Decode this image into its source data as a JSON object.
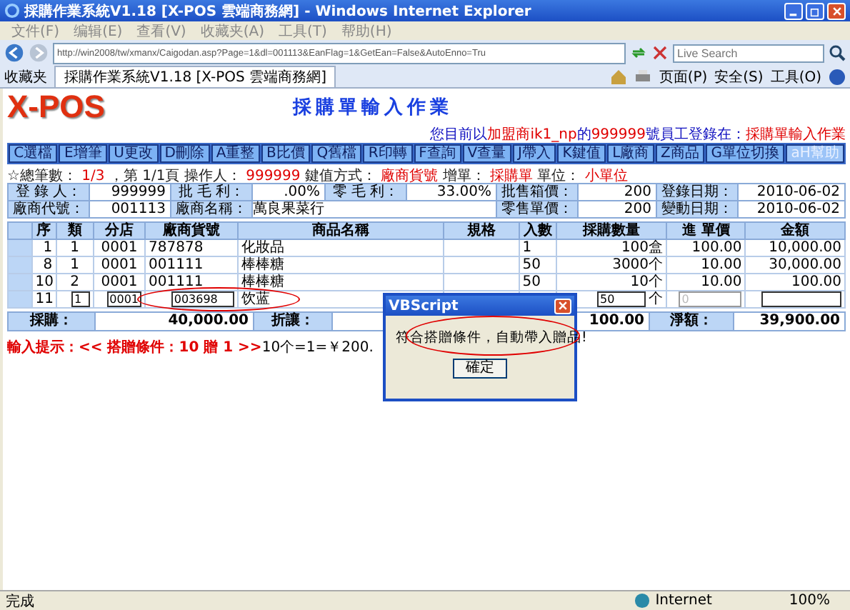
{
  "window": {
    "title": "採購作業系統V1.18 [X-POS 雲端商務網] - Windows Internet Explorer"
  },
  "menu": [
    "文件(F)",
    "编辑(E)",
    "查看(V)",
    "收藏夹(A)",
    "工具(T)",
    "帮助(H)"
  ],
  "address_bar": {
    "url": "http://win2008/tw/xmanx/Caigodan.asp?Page=1&dl=001113&EanFlag=1&GetEan=False&AutoEnno=Tru",
    "search_placeholder": "Live Search"
  },
  "favorites": "收藏夹",
  "tabs": [
    {
      "label": "採購作業系統V1.18 [X-POS 雲端商務網]",
      "selected": true
    }
  ],
  "browser_tools": [
    "页面(P)",
    "安全(S)",
    "工具(O)"
  ],
  "app": {
    "logo": "X-POS",
    "title": "採購單輸入作業",
    "user_note": [
      {
        "text": "您目前以",
        "emphasis": false
      },
      {
        "text": "加盟商ik1_np",
        "emphasis": true
      },
      {
        "text": "的",
        "emphasis": false
      },
      {
        "text": "999999",
        "emphasis": true
      },
      {
        "text": "號員工登錄在：",
        "emphasis": false
      },
      {
        "text": "採購單輸入作業",
        "emphasis": true
      }
    ],
    "toolbar": [
      {
        "label": "C選檔",
        "disabled": false
      },
      {
        "label": "E增筆",
        "disabled": false
      },
      {
        "label": "U更改",
        "disabled": false
      },
      {
        "label": "D刪除",
        "disabled": false
      },
      {
        "label": "A重整",
        "disabled": false
      },
      {
        "label": "B比價",
        "disabled": false
      },
      {
        "label": "Q舊檔",
        "disabled": false
      },
      {
        "label": "R印轉",
        "disabled": false
      },
      {
        "label": "F查詢",
        "disabled": false
      },
      {
        "label": "V查量",
        "disabled": false
      },
      {
        "label": "J帶入",
        "disabled": false
      },
      {
        "label": "K鍵值",
        "disabled": false
      },
      {
        "label": "L廠商",
        "disabled": false
      },
      {
        "label": "Z商品",
        "disabled": false
      },
      {
        "label": "G單位切換",
        "disabled": false
      },
      {
        "label": "aH幫助",
        "disabled": true
      }
    ],
    "info": [
      {
        "text": "☆總筆數：",
        "emphasis": false
      },
      {
        "text": "1/3",
        "emphasis": true
      },
      {
        "text": "，第 1/1頁",
        "emphasis": false
      },
      {
        "text": "操作人：",
        "emphasis": false
      },
      {
        "text": "999999",
        "emphasis": true
      },
      {
        "text": "鍵值方式：",
        "emphasis": false
      },
      {
        "text": "廠商貨號",
        "emphasis": true
      },
      {
        "text": "增單：",
        "emphasis": false
      },
      {
        "text": "採購單",
        "emphasis": true
      },
      {
        "text": "單位：",
        "emphasis": false
      },
      {
        "text": "小單位",
        "emphasis": true
      }
    ],
    "form": [
      [
        {
          "label": "登 錄 人：",
          "value": "999999"
        },
        {
          "label": "批 毛 利：",
          "value": ".00%"
        },
        {
          "label": "零 毛 利：",
          "value": "33.00%"
        },
        {
          "label": "批售箱價：",
          "value": "200"
        },
        {
          "label": "登錄日期：",
          "value": "2010-06-02"
        }
      ],
      [
        {
          "label": "廠商代號：",
          "value": "001113"
        },
        {
          "label": "廠商名稱：",
          "value": "萬良果菜行"
        },
        {
          "label": "零售單價：",
          "value": "200"
        },
        {
          "label": "變動日期：",
          "value": "2010-06-02"
        }
      ]
    ],
    "table": {
      "columns": [
        "序",
        "類",
        "分店",
        "廠商貨號",
        "商品名稱",
        "規格",
        "入數",
        "採購數量",
        "進 單價",
        "金額"
      ],
      "rows": [
        {
          "kind": "display",
          "cells": [
            "1",
            "1",
            "0001",
            "787878",
            "化妝品",
            "",
            "1",
            "100盒",
            "100.00",
            "10,000.00"
          ]
        },
        {
          "kind": "display",
          "cells": [
            "8",
            "1",
            "0001",
            "001111",
            "棒棒糖",
            "",
            "50",
            "3000个",
            "10.00",
            "30,000.00"
          ]
        },
        {
          "kind": "display",
          "cells": [
            "10",
            "2",
            "0001",
            "001111",
            "棒棒糖",
            "",
            "50",
            "10个",
            "10.00",
            "100.00"
          ]
        },
        {
          "kind": "input",
          "cells": [
            "11",
            "1",
            "0001",
            "003698",
            "饮蓝",
            "",
            "",
            "50",
            "0",
            ""
          ],
          "unit": "个"
        }
      ]
    },
    "totals": [
      {
        "label": "採購：",
        "value": "40,000.00"
      },
      {
        "label": "折讓："
      },
      {
        "value": "100.00"
      },
      {
        "label": "淨額：",
        "value": "39,900.00"
      }
    ],
    "hint": [
      {
        "text": "輸入提示：<< 搭贈條件：10 贈 1 >>",
        "emphasis": true
      },
      {
        "text": "10个=1=￥200.",
        "emphasis": false
      }
    ]
  },
  "dialog": {
    "title": "VBScript",
    "message": "符合搭贈條件，自動帶入贈品!",
    "button": "確定"
  },
  "status_bar": {
    "text": "完成",
    "zone": "Internet",
    "zoom": "100%"
  }
}
